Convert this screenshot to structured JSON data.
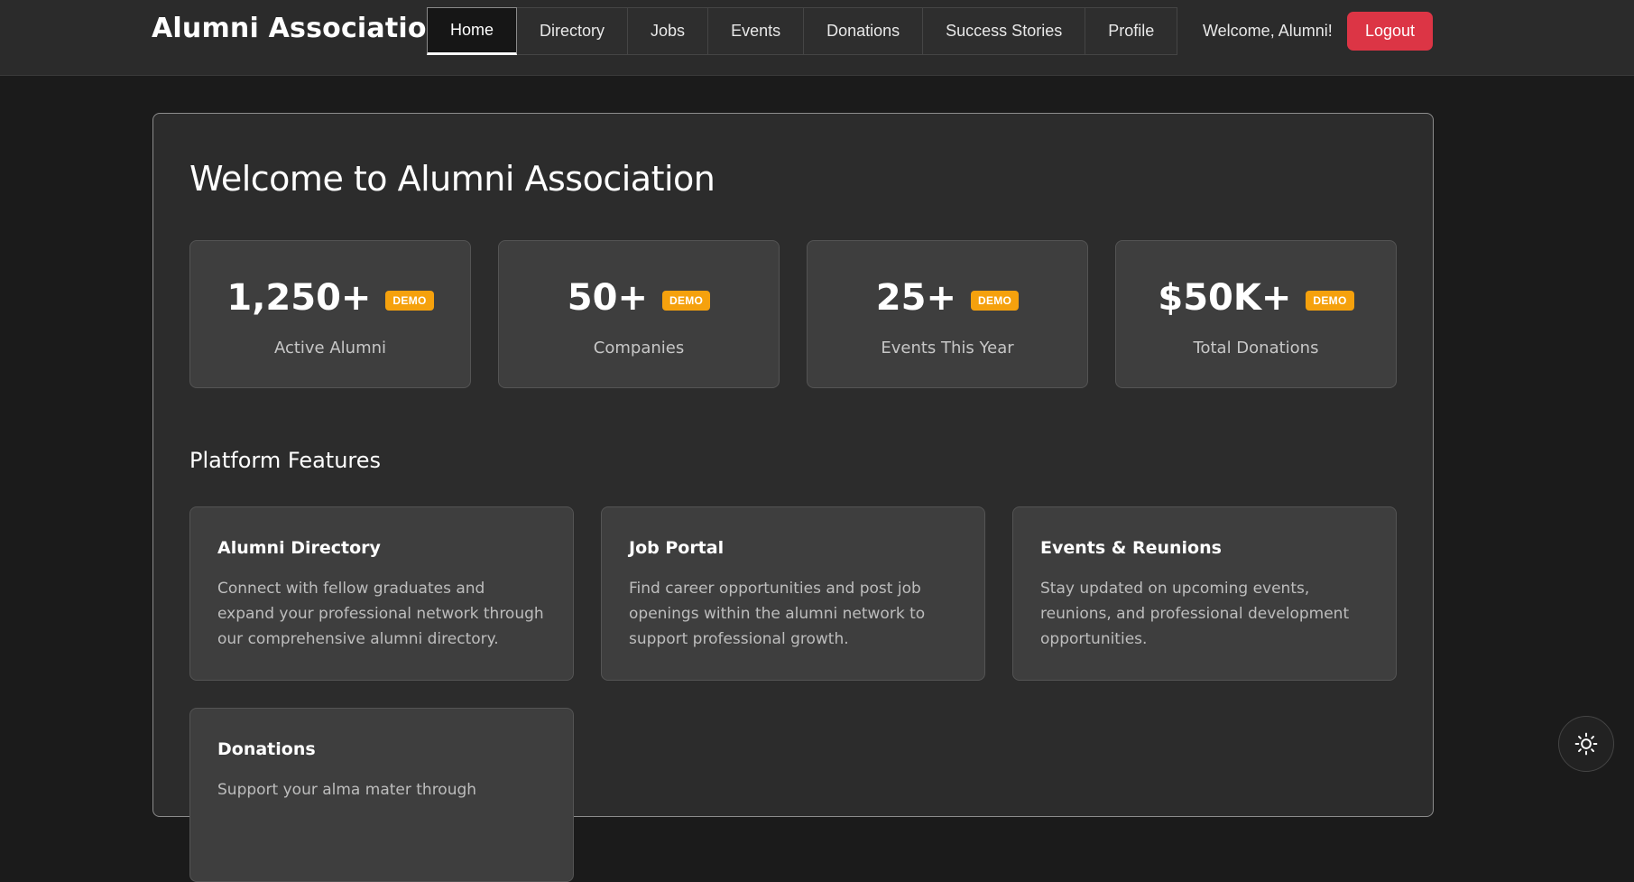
{
  "header": {
    "brand": "Alumni Association",
    "nav": [
      {
        "label": "Home",
        "active": true
      },
      {
        "label": "Directory",
        "active": false
      },
      {
        "label": "Jobs",
        "active": false
      },
      {
        "label": "Events",
        "active": false
      },
      {
        "label": "Donations",
        "active": false
      },
      {
        "label": "Success Stories",
        "active": false
      },
      {
        "label": "Profile",
        "active": false
      }
    ],
    "welcome": "Welcome, Alumni!",
    "logout_label": "Logout"
  },
  "main": {
    "title": "Welcome to Alumni Association",
    "stats": [
      {
        "value": "1,250+",
        "badge": "DEMO",
        "label": "Active Alumni"
      },
      {
        "value": "50+",
        "badge": "DEMO",
        "label": "Companies"
      },
      {
        "value": "25+",
        "badge": "DEMO",
        "label": "Events This Year"
      },
      {
        "value": "$50K+",
        "badge": "DEMO",
        "label": "Total Donations"
      }
    ],
    "features_title": "Platform Features",
    "features": [
      {
        "title": "Alumni Directory",
        "description": "Connect with fellow graduates and expand your professional network through our comprehensive alumni directory."
      },
      {
        "title": "Job Portal",
        "description": "Find career opportunities and post job openings within the alumni network to support professional growth."
      },
      {
        "title": "Events & Reunions",
        "description": "Stay updated on upcoming events, reunions, and professional development opportunities."
      },
      {
        "title": "Donations",
        "description": "Support your alma mater through"
      }
    ]
  },
  "theme_toggle": {
    "icon": "sun-icon"
  },
  "colors": {
    "background": "#1b1b1b",
    "header": "#2b2b2b",
    "card": "#3e3e3e",
    "logout": "#dc3545",
    "badge": "#f5a10d"
  }
}
